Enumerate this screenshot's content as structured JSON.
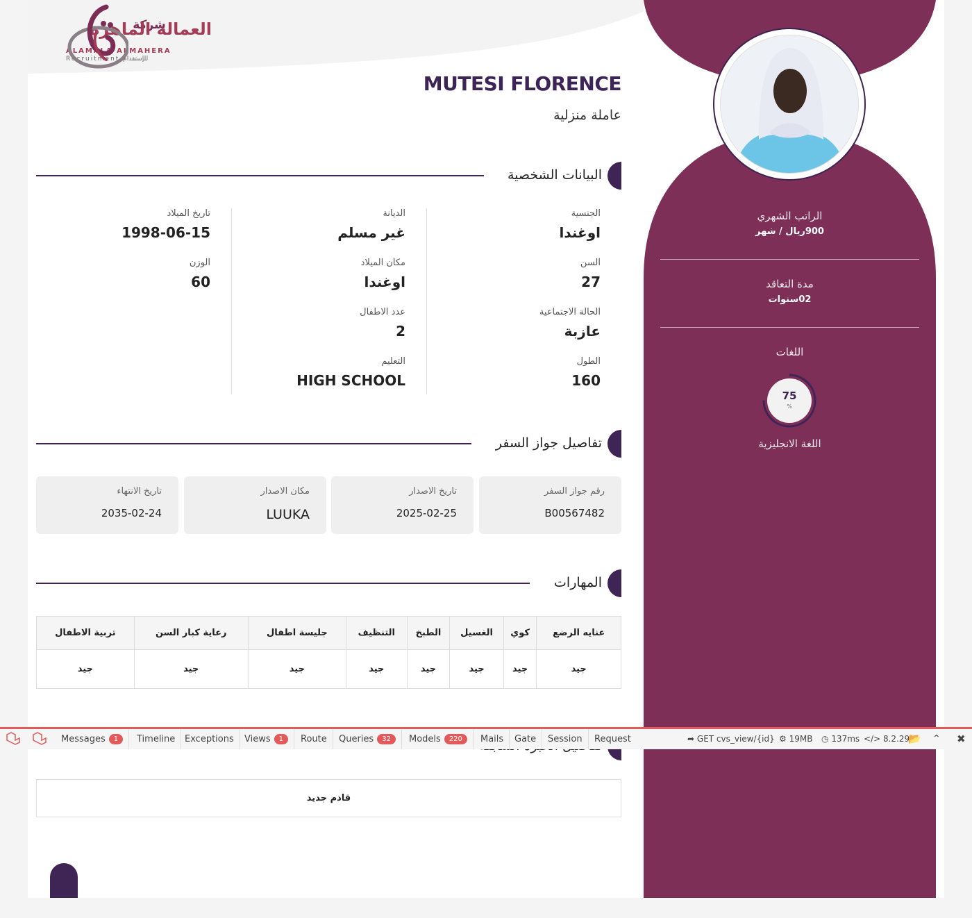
{
  "logo": {
    "arabic_top": "شركة",
    "arabic_name": "العمالة الماهرة",
    "english_name": "ALAMALA ALMAHERA",
    "english_sub": "Recruitment للإستقدام"
  },
  "profile": {
    "name": "MUTESI FLORENCE",
    "role": "عاملة منزلية"
  },
  "sidebar": {
    "salary_label": "الراتب الشهري",
    "salary_value": "900ريال / شهر",
    "contract_label": "مدة التعاقد",
    "contract_value": "02سنوات",
    "languages_label": "اللغات",
    "language_percent": 75,
    "language_percent_text": "75",
    "language_percent_sign": "%",
    "language_name": "اللغة الانجليزية"
  },
  "personal": {
    "title": "البيانات الشخصية",
    "fields": [
      {
        "label": "الجنسية",
        "value": "اوغندا"
      },
      {
        "label": "السن",
        "value": "27"
      },
      {
        "label": "الحالة الاجتماعية",
        "value": "عازبة"
      },
      {
        "label": "الطول",
        "value": "160"
      },
      {
        "label": "الديانة",
        "value": "غير مسلم"
      },
      {
        "label": "مكان الميلاد",
        "value": "اوغندا"
      },
      {
        "label": "عدد الاطفال",
        "value": "2"
      },
      {
        "label": "التعليم",
        "value": "HIGH SCHOOL"
      },
      {
        "label": "تاريخ الميلاد",
        "value": "1998-06-15"
      },
      {
        "label": "الوزن",
        "value": "60"
      }
    ]
  },
  "passport": {
    "title": "تفاصيل جواز السفر",
    "cards": [
      {
        "label": "رقم جواز السفر",
        "value": "B00567482"
      },
      {
        "label": "تاريخ الاصدار",
        "value": "2025-02-25"
      },
      {
        "label": "مكان الاصدار",
        "value": "LUUKA"
      },
      {
        "label": "تاريخ الانتهاء",
        "value": "2035-02-24"
      }
    ]
  },
  "skills": {
    "title": "المهارات",
    "headers": [
      "عنايه الرضع",
      "كوي",
      "الغسيل",
      "الطبخ",
      "التنظيف",
      "جليسة اطفال",
      "رعاية كبار السن",
      "تربية الاطفال"
    ],
    "values": [
      "جيد",
      "جيد",
      "جيد",
      "جيد",
      "جيد",
      "جيد",
      "جيد",
      "جيد"
    ]
  },
  "experience": {
    "title": "تفاصيل الخبرة السابقة",
    "value": "قادم جديد"
  },
  "debugbar": {
    "items": [
      {
        "label": "Messages",
        "badge": "1"
      },
      {
        "label": "Timeline",
        "badge": ""
      },
      {
        "label": "Exceptions",
        "badge": ""
      },
      {
        "label": "Views",
        "badge": "1"
      },
      {
        "label": "Route",
        "badge": ""
      },
      {
        "label": "Queries",
        "badge": "32"
      },
      {
        "label": "Models",
        "badge": "220"
      },
      {
        "label": "Mails",
        "badge": ""
      },
      {
        "label": "Gate",
        "badge": ""
      },
      {
        "label": "Session",
        "badge": ""
      },
      {
        "label": "Request",
        "badge": ""
      }
    ],
    "route": "GET cvs_view/{id}",
    "memory": "19MB",
    "time": "137ms",
    "version": "8.2.29"
  },
  "colors": {
    "sidebar": "#7d2f57",
    "accent": "#3f2456",
    "badge": "#e35a5a"
  }
}
